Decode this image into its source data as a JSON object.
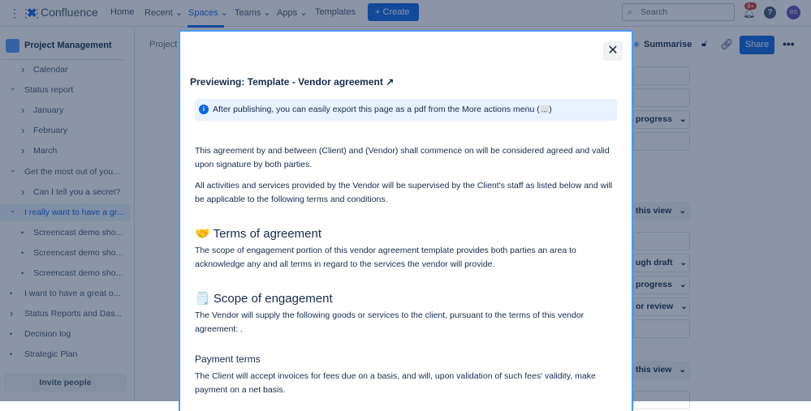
{
  "topbar": {
    "app": "Confluence",
    "nav": [
      "Home",
      "Recent",
      "Spaces",
      "Teams",
      "Apps",
      "Templates"
    ],
    "create": "Create",
    "search_placeholder": "Search",
    "notif_badge": "9+",
    "avatar": "BS"
  },
  "sidebar": {
    "space": "Project Management",
    "items": [
      {
        "label": "Calendar",
        "type": "chevron",
        "level": 2
      },
      {
        "label": "Status report",
        "type": "open",
        "level": 1
      },
      {
        "label": "January",
        "type": "chevron",
        "level": 2
      },
      {
        "label": "February",
        "type": "chevron",
        "level": 2
      },
      {
        "label": "March",
        "type": "chevron",
        "level": 2
      },
      {
        "label": "Get the most out of you...",
        "type": "open",
        "level": 1
      },
      {
        "label": "Can I tell you a secret?",
        "type": "chevron",
        "level": 2
      },
      {
        "label": "I really want to have a gr...",
        "type": "open",
        "level": 1,
        "selected": true
      },
      {
        "label": "Screencast demo sho...",
        "type": "bullet",
        "level": 2
      },
      {
        "label": "Screencast demo sho...",
        "type": "bullet",
        "level": 2
      },
      {
        "label": "Screencast demo sho...",
        "type": "bullet",
        "level": 2
      },
      {
        "label": "I want to have a great o...",
        "type": "bullet",
        "level": 1
      },
      {
        "label": "Status Reports and Das...",
        "type": "chevron",
        "level": 1
      },
      {
        "label": "Decision log",
        "type": "bullet",
        "level": 1
      },
      {
        "label": "Strategic Plan",
        "type": "bullet",
        "level": 1
      }
    ],
    "invite": "Invite people"
  },
  "page": {
    "breadcrumb": "Project I",
    "summarise": "Summarise",
    "share": "Share",
    "fields": [
      "",
      "",
      "progress",
      "",
      "this view",
      "",
      "ugh draft",
      "progress",
      "or review",
      "",
      "this view",
      ""
    ]
  },
  "modal": {
    "title": "Previewing: Template - Vendor agreement",
    "info": "After publishing, you can easily export this page as a pdf from the More actions menu (",
    "info_code": "...",
    "info_end": ")",
    "p1": "This agreement by and between (Client) and (Vendor) shall commence on will be considered agreed and valid upon signature by both parties.",
    "p2": "All activities and services provided by the Vendor will be supervised by the Client's staff as listed below and will be applicable to the following terms and conditions.",
    "h1_emoji": "🤝",
    "h1": "Terms of agreement",
    "p3": "The scope of engagement portion of this vendor agreement template provides both parties an area to acknowledge any and all terms in regard to the services the vendor will provide.",
    "h2_emoji": "🗒️",
    "h2": "Scope of engagement",
    "p4": "The Vendor will supply the following goods or services to the client, pursuant to the terms of this vendor agreement: .",
    "h3": "Payment terms",
    "p5": "The Client will accept invoices for fees due on a basis, and will, upon validation of such fees' validity, make payment on a net basis."
  }
}
